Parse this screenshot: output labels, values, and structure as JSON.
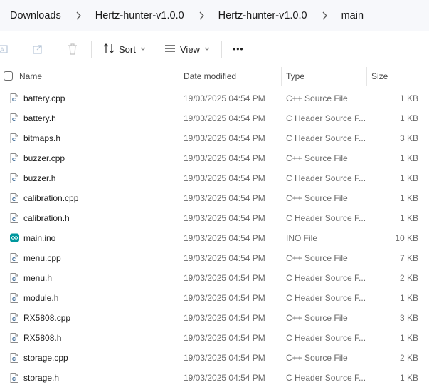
{
  "breadcrumb": {
    "items": [
      "Downloads",
      "Hertz-hunter-v1.0.0",
      "Hertz-hunter-v1.0.0",
      "main"
    ]
  },
  "toolbar": {
    "sort_label": "Sort",
    "view_label": "View",
    "more_label": "•••"
  },
  "columns": {
    "name": "Name",
    "date_modified": "Date modified",
    "type": "Type",
    "size": "Size"
  },
  "colors": {
    "c_icon": "#2f5f8f",
    "ino_icon": "#00979d",
    "accent": "#1f1f1f"
  },
  "files": [
    {
      "name": "battery.cpp",
      "date": "19/03/2025 04:54 PM",
      "type": "C++ Source File",
      "size": "1 KB",
      "icon": "c-file-icon"
    },
    {
      "name": "battery.h",
      "date": "19/03/2025 04:54 PM",
      "type": "C Header Source F...",
      "size": "1 KB",
      "icon": "c-file-icon"
    },
    {
      "name": "bitmaps.h",
      "date": "19/03/2025 04:54 PM",
      "type": "C Header Source F...",
      "size": "3 KB",
      "icon": "c-file-icon"
    },
    {
      "name": "buzzer.cpp",
      "date": "19/03/2025 04:54 PM",
      "type": "C++ Source File",
      "size": "1 KB",
      "icon": "c-file-icon"
    },
    {
      "name": "buzzer.h",
      "date": "19/03/2025 04:54 PM",
      "type": "C Header Source F...",
      "size": "1 KB",
      "icon": "c-file-icon"
    },
    {
      "name": "calibration.cpp",
      "date": "19/03/2025 04:54 PM",
      "type": "C++ Source File",
      "size": "1 KB",
      "icon": "c-file-icon"
    },
    {
      "name": "calibration.h",
      "date": "19/03/2025 04:54 PM",
      "type": "C Header Source F...",
      "size": "1 KB",
      "icon": "c-file-icon"
    },
    {
      "name": "main.ino",
      "date": "19/03/2025 04:54 PM",
      "type": "INO File",
      "size": "10 KB",
      "icon": "arduino-icon"
    },
    {
      "name": "menu.cpp",
      "date": "19/03/2025 04:54 PM",
      "type": "C++ Source File",
      "size": "7 KB",
      "icon": "c-file-icon"
    },
    {
      "name": "menu.h",
      "date": "19/03/2025 04:54 PM",
      "type": "C Header Source F...",
      "size": "2 KB",
      "icon": "c-file-icon"
    },
    {
      "name": "module.h",
      "date": "19/03/2025 04:54 PM",
      "type": "C Header Source F...",
      "size": "1 KB",
      "icon": "c-file-icon"
    },
    {
      "name": "RX5808.cpp",
      "date": "19/03/2025 04:54 PM",
      "type": "C++ Source File",
      "size": "3 KB",
      "icon": "c-file-icon"
    },
    {
      "name": "RX5808.h",
      "date": "19/03/2025 04:54 PM",
      "type": "C Header Source F...",
      "size": "1 KB",
      "icon": "c-file-icon"
    },
    {
      "name": "storage.cpp",
      "date": "19/03/2025 04:54 PM",
      "type": "C++ Source File",
      "size": "2 KB",
      "icon": "c-file-icon"
    },
    {
      "name": "storage.h",
      "date": "19/03/2025 04:54 PM",
      "type": "C Header Source F...",
      "size": "1 KB",
      "icon": "c-file-icon"
    }
  ]
}
